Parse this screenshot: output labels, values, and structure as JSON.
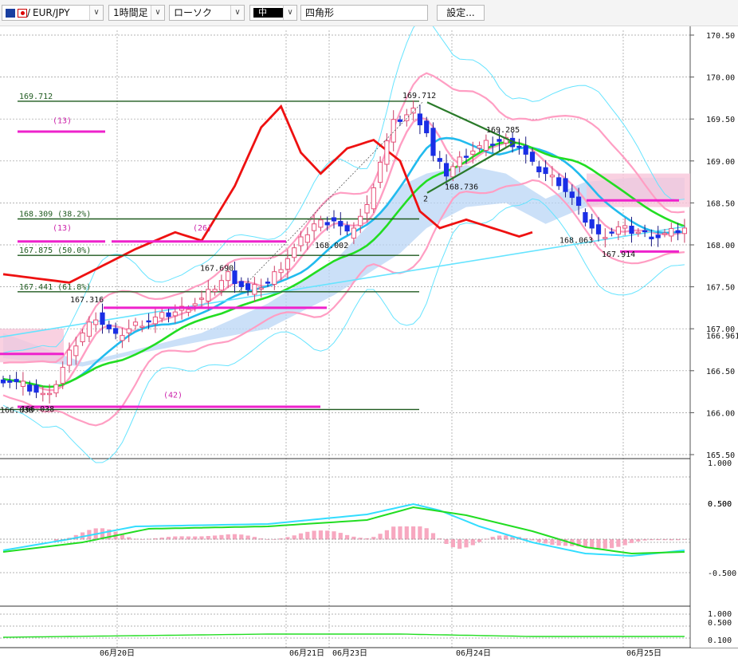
{
  "toolbar": {
    "symbol": "EUR/JPY",
    "symbol_prefix": "/",
    "timeframe": "1時間足",
    "chart_type": "ローソク",
    "color_label": "中",
    "drawing_tool": "四角形",
    "settings_label": "設定...",
    "dropdown_glyph": "∨"
  },
  "chart_data": {
    "type": "line",
    "title": "",
    "instrument": "EUR/JPY",
    "timeframe": "1時間足",
    "y_axis": {
      "min": 165.5,
      "max": 170.5,
      "ticks": [
        "170.50",
        "170.00",
        "169.50",
        "169.00",
        "168.50",
        "168.00",
        "167.50",
        "167.00",
        "166.50",
        "166.00",
        "165.50"
      ]
    },
    "current_price_label": "166.961",
    "x_date_labels": [
      "06月20日",
      "06月21日",
      "06月23日",
      "06月24日",
      "06月25日"
    ],
    "fib_levels": [
      {
        "label": "169.712",
        "value": 169.712
      },
      {
        "label": "168.309 (38.2%)",
        "value": 168.309
      },
      {
        "label": "167.875 (50.0%)",
        "value": 167.875
      },
      {
        "label": "167.441 (61.8%)",
        "value": 167.441
      },
      {
        "label": "",
        "value": 166.038
      }
    ],
    "price_annotations": [
      {
        "text": "169.712",
        "value": 169.712
      },
      {
        "text": "169.285",
        "value": 169.285
      },
      {
        "text": "168.736",
        "value": 168.736
      },
      {
        "text": "168.063",
        "value": 168.063
      },
      {
        "text": "167.914",
        "value": 167.914
      },
      {
        "text": "168.002",
        "value": 168.002
      },
      {
        "text": "167.690",
        "value": 167.69
      },
      {
        "text": "167.316",
        "value": 167.316
      },
      {
        "text": "166.038",
        "value": 166.038
      }
    ],
    "count_labels": [
      "(13)",
      "(13)",
      "(26)",
      "(42)"
    ],
    "wave_label": "2",
    "rsi_panel": {
      "ticks": [
        "1.000",
        "0.500",
        "0.100"
      ]
    },
    "macd_panel": {
      "ticks": [
        "0.500",
        "-0.500"
      ]
    },
    "colors": {
      "bull_candle": "#e8507a",
      "bear_candle": "#1a2ee6",
      "red_line": "#ee1111",
      "ma_fast": "#ff9ec3",
      "ma_mid": "#22bbee",
      "ma_slow": "#22dd22",
      "bollinger": "#66e4ff",
      "fib_line": "#1f5a1f",
      "magenta": "#ee22cc",
      "cloud": "#b9d6f6"
    },
    "grid": true
  }
}
